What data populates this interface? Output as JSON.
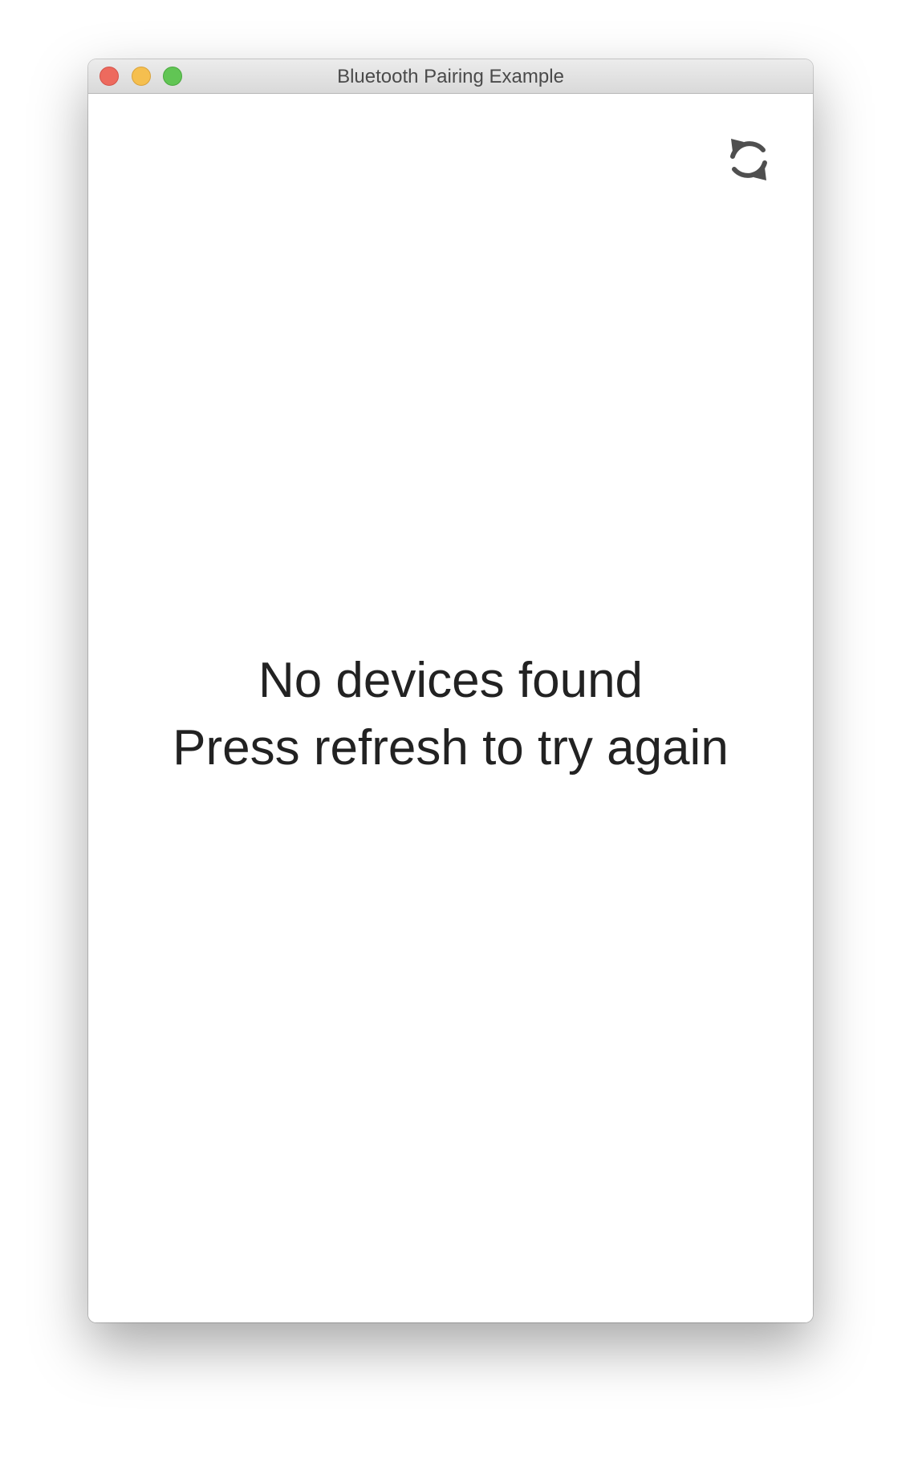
{
  "window": {
    "title": "Bluetooth Pairing Example",
    "controls": {
      "close_color": "#ed6a5e",
      "minimize_color": "#f5bf4f",
      "zoom_color": "#61c554"
    }
  },
  "toolbar": {
    "refresh_icon": "refresh-icon"
  },
  "empty_state": {
    "line1": "No devices found",
    "line2": "Press refresh to try again"
  }
}
